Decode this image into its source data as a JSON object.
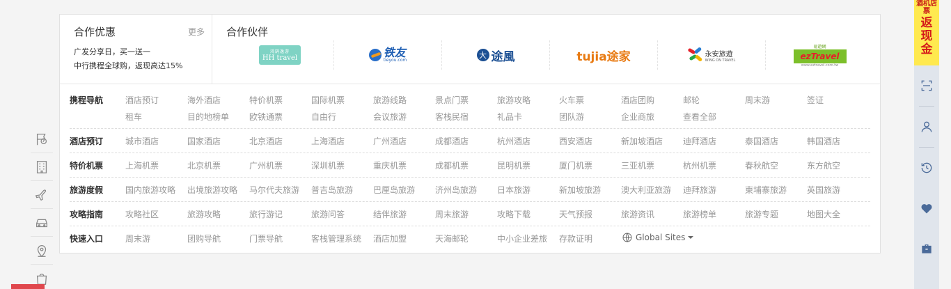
{
  "promo": {
    "title": "合作优惠",
    "more": "更多",
    "lines": [
      "广发分享日，买一送一",
      "中行携程全球购，返现高达15%"
    ]
  },
  "partners": {
    "title": "合作伙伴",
    "logos": [
      {
        "name": "hh-travel",
        "small": "鸿鹄逸游",
        "text": "HH travel"
      },
      {
        "name": "tieyou",
        "cn": "铁友",
        "en": "tieyou.com"
      },
      {
        "name": "tufeng",
        "cn": "途風"
      },
      {
        "name": "tujia",
        "text": "tujia途家"
      },
      {
        "name": "yongan",
        "cn": "永安旅遊",
        "en": "WING ON TRAVEL"
      },
      {
        "name": "eztravel",
        "top": "易遊網",
        "text": "ezTravel",
        "bottom": "www.eztravel.com.tw"
      }
    ]
  },
  "grid": {
    "rows": [
      {
        "category": "携程导航",
        "links": [
          [
            "酒店预订",
            "海外酒店",
            "特价机票",
            "国际机票",
            "旅游线路",
            "景点门票",
            "旅游攻略",
            "火车票",
            "酒店团购",
            "邮轮",
            "周末游",
            "签证"
          ],
          [
            "租车",
            "目的地榜单",
            "欧铁通票",
            "自由行",
            "会议旅游",
            "客栈民宿",
            "礼品卡",
            "团队游",
            "企业商旅",
            "查看全部"
          ]
        ]
      },
      {
        "category": "酒店预订",
        "links": [
          [
            "城市酒店",
            "国家酒店",
            "北京酒店",
            "上海酒店",
            "广州酒店",
            "成都酒店",
            "杭州酒店",
            "西安酒店",
            "新加坡酒店",
            "迪拜酒店",
            "泰国酒店",
            "韩国酒店"
          ]
        ]
      },
      {
        "category": "特价机票",
        "links": [
          [
            "上海机票",
            "北京机票",
            "广州机票",
            "深圳机票",
            "重庆机票",
            "成都机票",
            "昆明机票",
            "厦门机票",
            "三亚机票",
            "杭州机票",
            "春秋航空",
            "东方航空"
          ]
        ]
      },
      {
        "category": "旅游度假",
        "links": [
          [
            "国内旅游攻略",
            "出境旅游攻略",
            "马尔代夫旅游",
            "普吉岛旅游",
            "巴厘岛旅游",
            "济州岛旅游",
            "日本旅游",
            "新加坡旅游",
            "澳大利亚旅游",
            "迪拜旅游",
            "柬埔寨旅游",
            "英国旅游"
          ]
        ]
      },
      {
        "category": "攻略指南",
        "links": [
          [
            "攻略社区",
            "旅游攻略",
            "旅行游记",
            "旅游问答",
            "结伴旅游",
            "周末旅游",
            "攻略下载",
            "天气预报",
            "旅游资讯",
            "旅游榜单",
            "旅游专题",
            "地图大全"
          ]
        ]
      },
      {
        "category": "快速入口",
        "links": [
          [
            "周末游",
            "团购导航",
            "门票导航",
            "客栈管理系统",
            "酒店加盟",
            "天海邮轮",
            "中小企业差旅",
            "存款证明"
          ]
        ]
      }
    ],
    "global_sites": "Global Sites"
  },
  "rightbar": {
    "small": "酒机店票",
    "big": "返现金"
  }
}
